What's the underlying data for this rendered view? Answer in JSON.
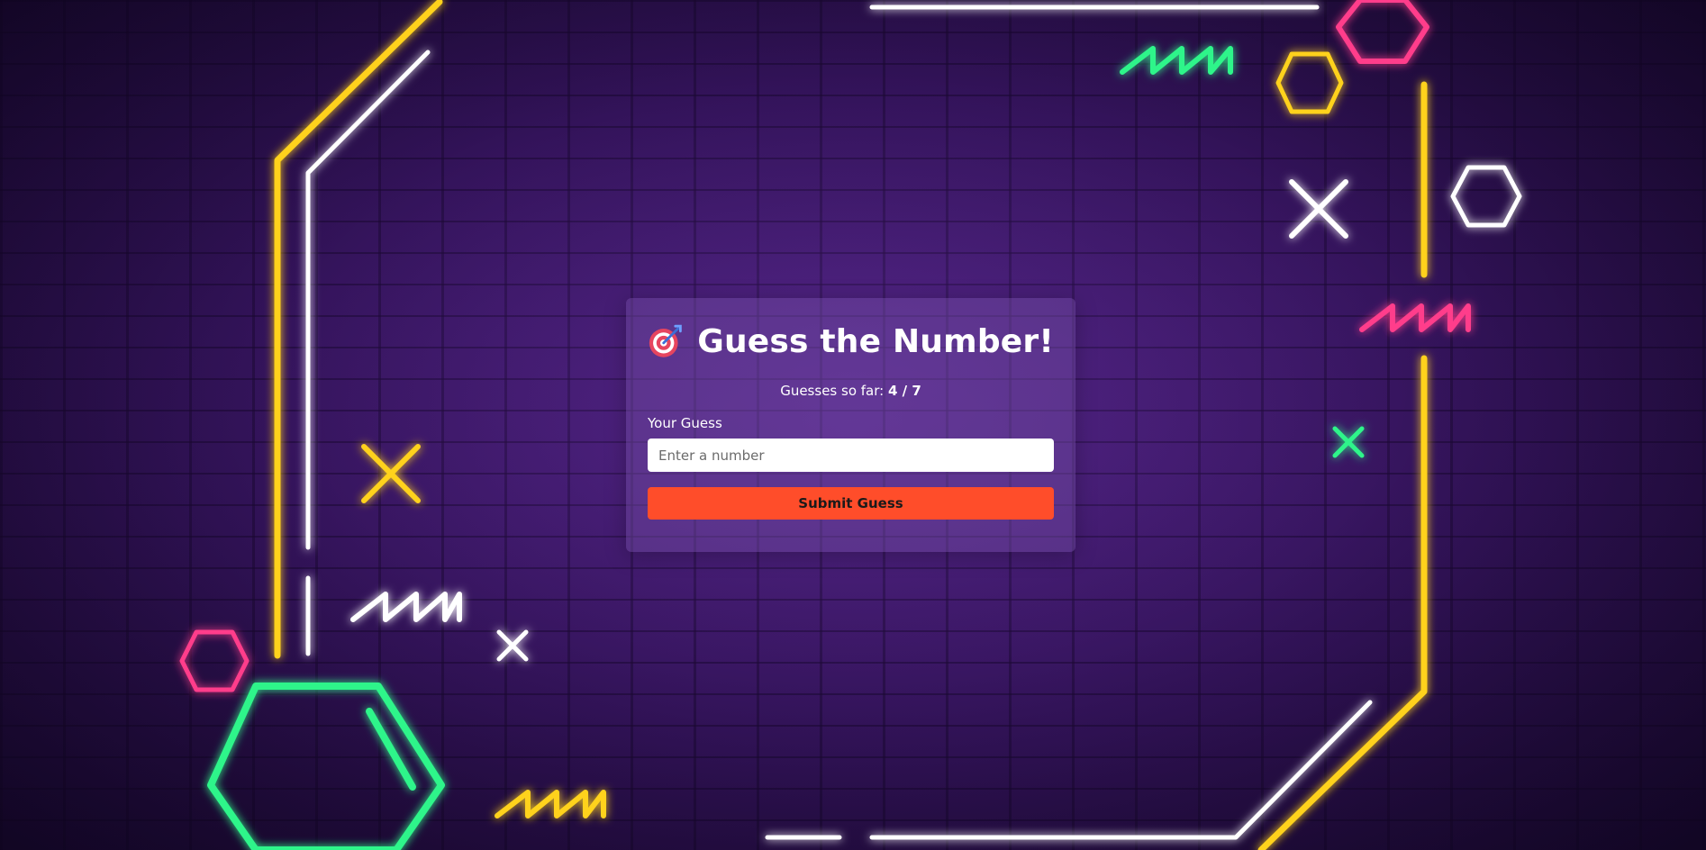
{
  "game": {
    "title": "Guess the Number!",
    "title_icon": "direct-hit-target-icon",
    "guesses_prefix": "Guesses so far:",
    "guesses_value": "4 / 7",
    "input_label": "Your Guess",
    "input_placeholder": "Enter a number",
    "input_value": "",
    "submit_label": "Submit Guess"
  },
  "colors": {
    "card_background": "#7850aa",
    "submit_button": "#ff4d2a",
    "neon_yellow": "#ffd21f",
    "neon_white": "#ffffff",
    "neon_green": "#2ef58a",
    "neon_pink": "#ff3d8b",
    "background": "#3a1766"
  },
  "decor": {
    "background": "purple-brick-wall",
    "shapes": [
      "neon-frame",
      "hexagon-icon",
      "x-cross-icon",
      "zigzag-line"
    ]
  }
}
